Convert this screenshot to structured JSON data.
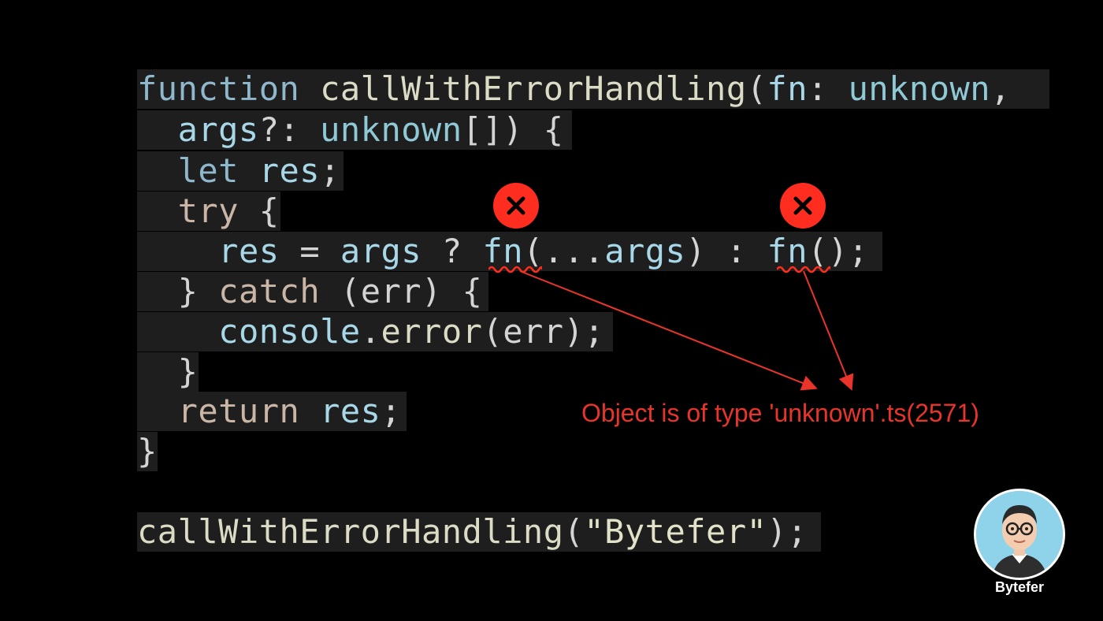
{
  "code": {
    "line1": {
      "kw": "function",
      "name": "callWithErrorHandling",
      "open": "(",
      "param": "fn",
      "colon": ":",
      "type": "unknown",
      "comma": ","
    },
    "line2": {
      "param": "args",
      "q": "?:",
      "type": "unknown",
      "rest": "[]) {"
    },
    "line3": {
      "kw": "let",
      "var": "res",
      "semi": ";"
    },
    "line4": {
      "kw": "try",
      "rest": "{"
    },
    "line5": {
      "var": "res",
      "eq": "=",
      "args1": "args",
      "q": "?",
      "fn1": "fn",
      "call1": "(...",
      "args2": "args",
      "mid": ") :",
      "fn2": "fn",
      "call2": "();"
    },
    "line6": {
      "close": "}",
      "kw": "catch",
      "rest": "(err) {"
    },
    "line7": {
      "obj": "console",
      "dot": ".",
      "method": "error",
      "rest": "(err);"
    },
    "line8": {
      "close": "}"
    },
    "line9": {
      "kw": "return",
      "var": "res",
      "semi": ";"
    },
    "line10": {
      "close": "}"
    },
    "line11": {
      "name": "callWithErrorHandling",
      "open": "(",
      "str": "\"Bytefer\"",
      "close": ");"
    }
  },
  "error_message": "Object is of type 'unknown'.ts(2571)",
  "avatar": {
    "label": "Bytefer"
  },
  "icons": {
    "error": "error-x-icon"
  },
  "colors": {
    "error": "#ff2d1f",
    "background": "#000000",
    "code_bg": "#1e1e1e"
  }
}
